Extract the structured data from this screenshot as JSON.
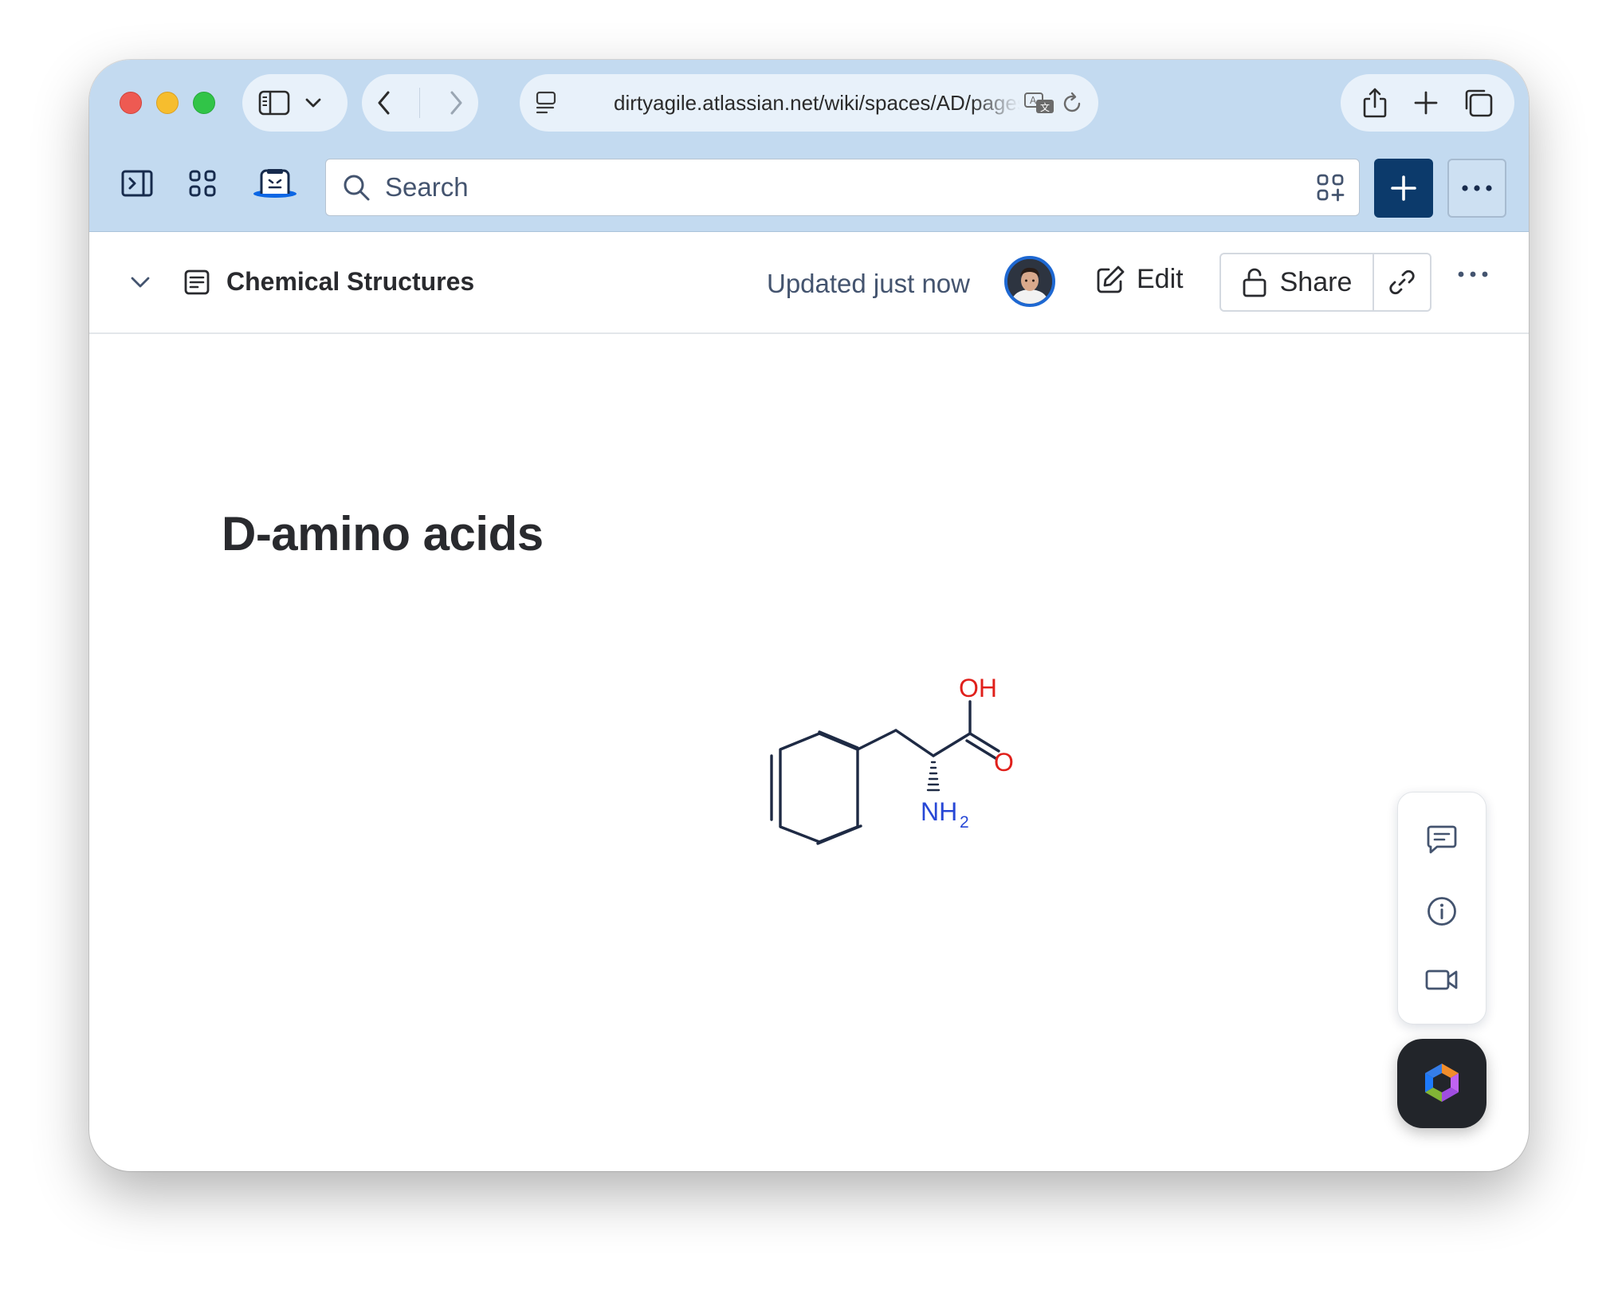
{
  "browser": {
    "url": "dirtyagile.atlassian.net/wiki/spaces/AD/pages",
    "traffic_lights": [
      "close",
      "minimize",
      "maximize"
    ],
    "icons": [
      "sidebar-icon",
      "chevron-down-icon",
      "back-icon",
      "forward-icon",
      "page-settings-icon",
      "translate-icon",
      "reload-icon",
      "share-icon",
      "new-tab-icon",
      "tabs-overview-icon"
    ]
  },
  "topnav": {
    "search_placeholder": "Search",
    "icons": [
      "expand-sidebar-icon",
      "app-switcher-icon",
      "confluence-logo-icon",
      "search-icon",
      "search-filter-icon",
      "plus-icon",
      "more-icon"
    ]
  },
  "page_header": {
    "title": "Chemical Structures",
    "updated": "Updated just now",
    "edit_label": "Edit",
    "share_label": "Share"
  },
  "content": {
    "heading": "D-amino acids",
    "molecule": {
      "labels": {
        "oh": "OH",
        "o": "O",
        "nh": "NH",
        "subscript": "2"
      },
      "colors": {
        "bond": "#1e2a44",
        "oxygen": "#e0201b",
        "nitrogen": "#2747d6"
      }
    }
  },
  "side_panel": {
    "icons": [
      "comment-icon",
      "info-icon",
      "video-icon"
    ]
  },
  "colors": {
    "chrome": "#c3daf0",
    "create_button": "#0c3a6b",
    "avatar_ring": "#1e68d2",
    "text_primary": "#292a2e",
    "text_secondary": "#44546f"
  }
}
